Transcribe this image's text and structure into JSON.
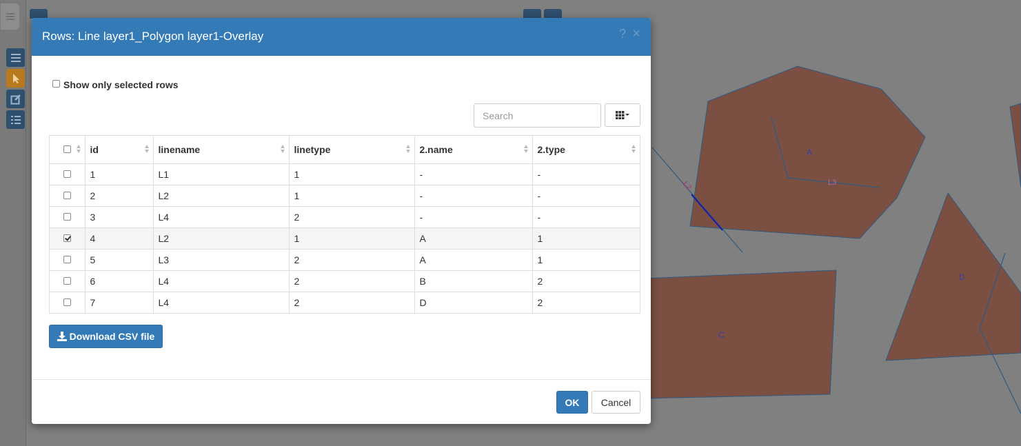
{
  "dialog": {
    "title": "Rows: Line layer1_Polygon layer1-Overlay",
    "help_glyph": "?",
    "close_glyph": "×",
    "show_selected_label": "Show only selected rows",
    "search_placeholder": "Search",
    "download_label": "Download CSV file",
    "ok_label": "OK",
    "cancel_label": "Cancel"
  },
  "table": {
    "columns": [
      "id",
      "linename",
      "linetype",
      "2.name",
      "2.type"
    ],
    "rows": [
      {
        "checked": false,
        "cells": [
          "1",
          "L1",
          "1",
          "-",
          "-"
        ]
      },
      {
        "checked": false,
        "cells": [
          "2",
          "L2",
          "1",
          "-",
          "-"
        ]
      },
      {
        "checked": false,
        "cells": [
          "3",
          "L4",
          "2",
          "-",
          "-"
        ]
      },
      {
        "checked": true,
        "cells": [
          "4",
          "L2",
          "1",
          "A",
          "1"
        ]
      },
      {
        "checked": false,
        "cells": [
          "5",
          "L3",
          "2",
          "A",
          "1"
        ]
      },
      {
        "checked": false,
        "cells": [
          "6",
          "L4",
          "2",
          "B",
          "2"
        ]
      },
      {
        "checked": false,
        "cells": [
          "7",
          "L4",
          "2",
          "D",
          "2"
        ]
      }
    ]
  },
  "map": {
    "labels": {
      "A": "A",
      "C": "C",
      "D": "D",
      "L2": "L2",
      "L3": "L3"
    },
    "polygon_color": "#7b4f42",
    "line_color": "#2d5a80"
  },
  "colors": {
    "primary": "#337ab7",
    "active_tool": "#b8791f",
    "tool": "#2f4f6e"
  }
}
